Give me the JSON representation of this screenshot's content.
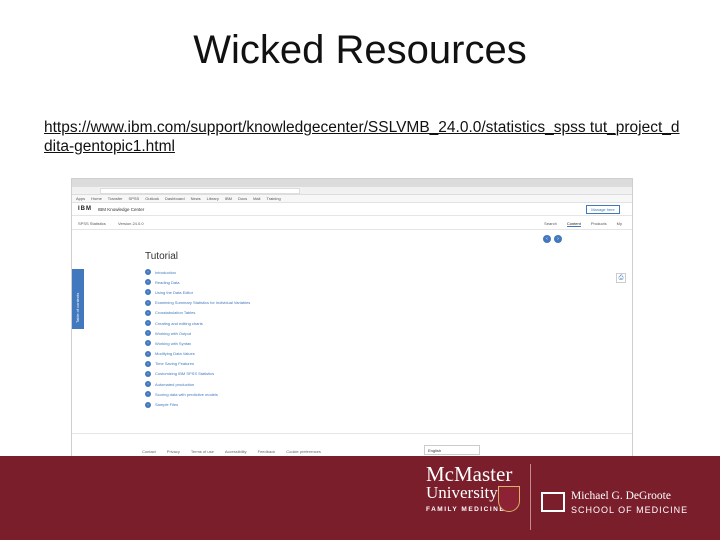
{
  "slide": {
    "title": "Wicked Resources",
    "link": "https://www.ibm.com/support/knowledgecenter/SSLVMB_24.0.0/statistics_spss tut_project_ddita-gentopic1.html"
  },
  "browser": {
    "bookmarks": [
      "Apps",
      "Home",
      "Transfer",
      "SPSS",
      "Outlook",
      "Dashboard",
      "News",
      "Library",
      "IBM",
      "Docs",
      "Mail",
      "Training"
    ],
    "ibm": {
      "logo": "IBM",
      "title": "IBM Knowledge Center",
      "account_button": "Manage here",
      "product": "SPSS Statistics",
      "version": "Version 24.0.0",
      "tabs": [
        "Search",
        "Content",
        "Products",
        "My"
      ]
    },
    "pager": [
      "‹",
      "›"
    ],
    "toc_tab": "Table of contents",
    "page_heading": "Tutorial",
    "toc_items": [
      "Introduction",
      "Reading Data",
      "Using the Data Editor",
      "Examining Summary Statistics for Individual Variables",
      "Crosstabulation Tables",
      "Creating and editing charts",
      "Working with Output",
      "Working with Syntax",
      "Modifying Data Values",
      "Time Saving Features",
      "Customizing IBM SPSS Statistics",
      "Automated production",
      "Scoring data with predictive models",
      "Sample Files"
    ],
    "footer": {
      "links": [
        "Contact",
        "Privacy",
        "Terms of use",
        "Accessibility",
        "Feedback",
        "Cookie preferences"
      ],
      "language": "English",
      "contact_button": "Contact us"
    }
  },
  "banner": {
    "mcmaster_line1": "McMaster",
    "mcmaster_line2": "University",
    "mcmaster_line3": "FAMILY MEDICINE",
    "degroote_name": "Michael G. DeGroote",
    "degroote_school": "SCHOOL OF MEDICINE",
    "color": "#7a1e2c"
  }
}
